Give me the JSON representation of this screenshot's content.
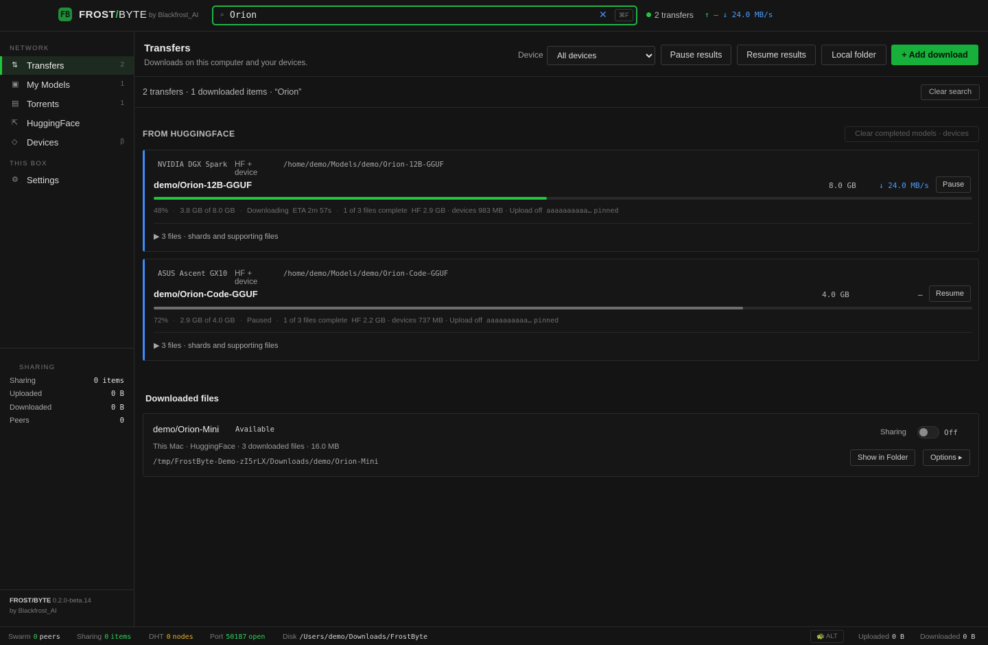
{
  "brand": {
    "logo_letter": "FB",
    "name_a": "FROST",
    "slash": "/",
    "name_b": "BYTE",
    "by": "by Blackfrost_AI"
  },
  "search": {
    "value": "Orion",
    "clear_icon": "close-icon",
    "shortcut": "⌘F"
  },
  "top_status": {
    "transfers": "2 transfers",
    "up_arrow": "↑",
    "up_rate": "—",
    "down_arrow": "↓",
    "down_rate": "24.0 MB/s"
  },
  "sidebar": {
    "section_network": "NETWORK",
    "section_this_box": "THIS BOX",
    "items": [
      {
        "icon": "⇅",
        "label": "Transfers",
        "count": "2"
      },
      {
        "icon": "▣",
        "label": "My Models",
        "count": "1"
      },
      {
        "icon": "▤",
        "label": "Torrents",
        "count": "1"
      },
      {
        "icon": "⇱",
        "label": "HuggingFace",
        "count": ""
      },
      {
        "icon": "◇",
        "label": "Devices",
        "count": "β"
      },
      {
        "icon": "⚙",
        "label": "Settings",
        "count": ""
      }
    ],
    "sharing": {
      "title": "SHARING",
      "rows": [
        {
          "label": "Sharing",
          "value": "0 items"
        },
        {
          "label": "Uploaded",
          "value": "0 B"
        },
        {
          "label": "Downloaded",
          "value": "0 B"
        },
        {
          "label": "Peers",
          "value": "0"
        }
      ]
    },
    "version_name": "FROST/BYTE",
    "version": "0.2.0-beta.14",
    "by": "by Blackfrost_AI"
  },
  "header": {
    "title": "Transfers",
    "subtitle": "Downloads on this computer and your devices.",
    "device_label": "Device",
    "device_value": "All devices",
    "pause_results": "Pause results",
    "resume_results": "Resume results",
    "local_folder": "Local folder",
    "add_download": "+ Add download"
  },
  "summary": {
    "text": "2 transfers · 1 downloaded items · “Orion”",
    "clear_search": "Clear search"
  },
  "hf_section": {
    "title": "FROM HUGGINGFACE",
    "clear_completed": "Clear completed models · devices"
  },
  "transfers": [
    {
      "device": "NVIDIA DGX Spark",
      "source": "HF + device",
      "path": "/home/demo/Models/demo/Orion-12B-GGUF",
      "name": "demo/Orion-12B-GGUF",
      "size": "8.0 GB",
      "rate": "↓ 24.0 MB/s",
      "action": "Pause",
      "progress": 0.48,
      "color": "#22c53e",
      "percent": "48%",
      "amount": "3.8 GB of 8.0 GB",
      "state": "Downloading",
      "eta": "ETA 2m 57s",
      "files_complete": "1 of 3 files complete",
      "split": "HF 2.9 GB · devices 983 MB · Upload off",
      "hash": "aaaaaaaaaa…",
      "pinned": "pinned",
      "files": "▶ 3 files · shards and supporting files"
    },
    {
      "device": "ASUS Ascent GX10",
      "source": "HF + device",
      "path": "/home/demo/Models/demo/Orion-Code-GGUF",
      "name": "demo/Orion-Code-GGUF",
      "size": "4.0 GB",
      "rate": "—",
      "action": "Resume",
      "progress": 0.72,
      "color": "#6e6e6e",
      "percent": "72%",
      "amount": "2.9 GB of 4.0 GB",
      "state": "Paused",
      "eta": "",
      "files_complete": "1 of 3 files complete",
      "split": "HF 2.2 GB · devices 737 MB · Upload off",
      "hash": "aaaaaaaaaa…",
      "pinned": "pinned",
      "files": "▶ 3 files · shards and supporting files"
    }
  ],
  "downloaded": {
    "title": "Downloaded files",
    "name": "demo/Orion-Mini",
    "status": "Available",
    "info": "This Mac · HuggingFace · 3 downloaded files · 16.0 MB",
    "path": "/tmp/FrostByte-Demo-zI5rLX/Downloads/demo/Orion-Mini",
    "sharing_label": "Sharing",
    "sharing_state": "Off",
    "show_in_folder": "Show in Folder",
    "options": "Options ▸"
  },
  "footer": {
    "swarm_label": "Swarm",
    "swarm_value": "0",
    "swarm_unit": "peers",
    "sharing_label": "Sharing",
    "sharing_value": "0",
    "sharing_unit": "items",
    "dht_label": "DHT",
    "dht_value": "0",
    "dht_unit": "nodes",
    "port_label": "Port",
    "port_value": "50187",
    "port_unit": "open",
    "disk_label": "Disk",
    "disk_value": "/Users/demo/Downloads/FrostByte",
    "alt": "🐢 ALT",
    "uploaded_label": "Uploaded",
    "uploaded_value": "0 B",
    "downloaded_label": "Downloaded",
    "downloaded_value": "0 B"
  }
}
